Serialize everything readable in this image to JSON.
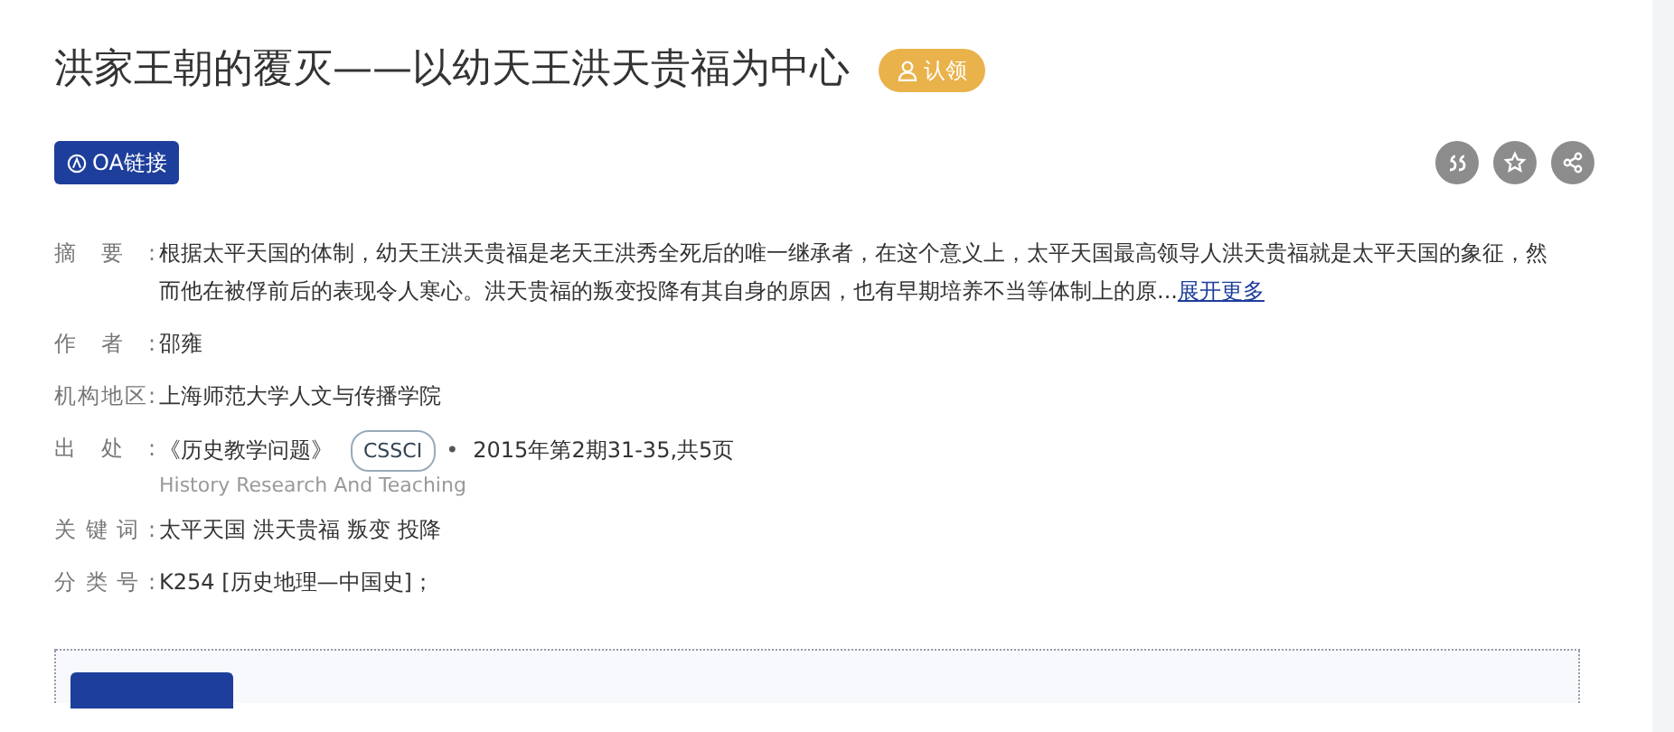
{
  "title": "洪家王朝的覆灭——以幼天王洪天贵福为中心",
  "claim_badge": "认领",
  "oa_button": "OA链接",
  "actions": [
    {
      "kind": "cite"
    },
    {
      "kind": "favorite"
    },
    {
      "kind": "share"
    }
  ],
  "fields": [
    {
      "kind": "abstract",
      "label": "摘要:",
      "value": "根据太平天国的体制，幼天王洪天贵福是老天王洪秀全死后的唯一继承者，在这个意义上，太平天国最高领导人洪天贵福就是太平天国的象征，然而他在被俘前后的表现令人寒心。洪天贵福的叛变投降有其自身的原因，也有早期培养不当等体制上的原...",
      "more": "展开更多"
    },
    {
      "kind": "text",
      "label": "作者:",
      "value": "邵雍"
    },
    {
      "kind": "text",
      "label": "机构地区:",
      "value": "上海师范大学人文与传播学院"
    },
    {
      "kind": "source",
      "label": "出处:",
      "journal": "《历史教学问题》",
      "tag": "CSSCI",
      "separator": "•",
      "issue": "2015年第2期31-35,共5页",
      "english": "History Research And Teaching"
    },
    {
      "kind": "keywords",
      "label": "关键词:",
      "keywords": [
        "太平天国",
        "洪天贵福",
        "叛变",
        "投降"
      ]
    },
    {
      "kind": "text",
      "label": "分类号:",
      "value": "K254 [历史地理—中国史]；"
    }
  ]
}
